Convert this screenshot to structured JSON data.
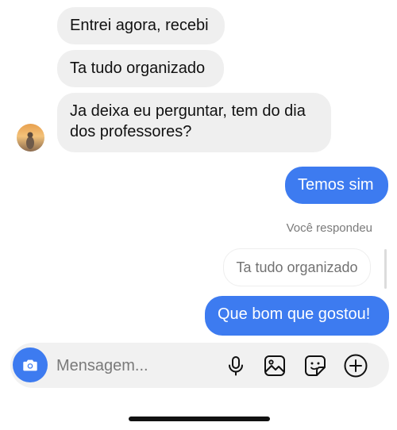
{
  "thread": {
    "incoming": [
      {
        "text": "Entrei agora, recebi"
      },
      {
        "text": "Ta tudo organizado"
      },
      {
        "text": "Ja deixa eu perguntar, tem do dia dos professores?"
      }
    ],
    "outgoing": [
      {
        "text": "Temos sim"
      },
      {
        "text": "Que bom que gostou!"
      }
    ],
    "reply": {
      "label": "Você respondeu",
      "quoted_text": "Ta tudo organizado"
    }
  },
  "composer": {
    "placeholder": "Mensagem...",
    "icons": [
      "camera-icon",
      "microphone-icon",
      "gallery-icon",
      "sticker-icon",
      "add-icon"
    ]
  },
  "colors": {
    "outgoing_bubble": "#3d7bf0",
    "incoming_bubble": "#efefef",
    "camera_button": "#3d7bf0"
  }
}
